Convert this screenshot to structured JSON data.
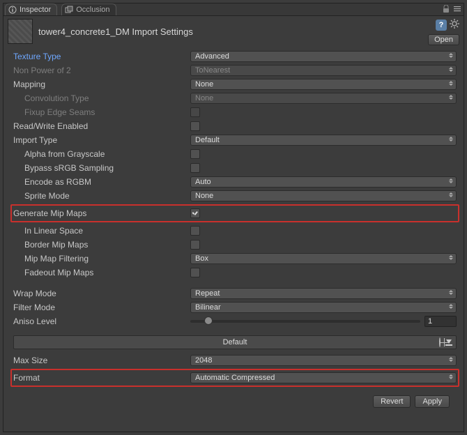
{
  "tabs": {
    "inspector": "Inspector",
    "occlusion": "Occlusion"
  },
  "header": {
    "title": "tower4_concrete1_DM Import Settings",
    "open": "Open"
  },
  "fields": {
    "texture_type": {
      "label": "Texture Type",
      "value": "Advanced"
    },
    "non_power_of_2": {
      "label": "Non Power of 2",
      "value": "ToNearest"
    },
    "mapping": {
      "label": "Mapping",
      "value": "None"
    },
    "convolution_type": {
      "label": "Convolution Type",
      "value": "None"
    },
    "fixup_edge_seams": {
      "label": "Fixup Edge Seams",
      "checked": false
    },
    "read_write_enabled": {
      "label": "Read/Write Enabled",
      "checked": false
    },
    "import_type": {
      "label": "Import Type",
      "value": "Default"
    },
    "alpha_from_grayscale": {
      "label": "Alpha from Grayscale",
      "checked": false
    },
    "bypass_srgb": {
      "label": "Bypass sRGB Sampling",
      "checked": false
    },
    "encode_as_rgbm": {
      "label": "Encode as RGBM",
      "value": "Auto"
    },
    "sprite_mode": {
      "label": "Sprite Mode",
      "value": "None"
    },
    "generate_mip_maps": {
      "label": "Generate Mip Maps",
      "checked": true
    },
    "in_linear_space": {
      "label": "In Linear Space",
      "checked": false
    },
    "border_mip_maps": {
      "label": "Border Mip Maps",
      "checked": false
    },
    "mip_map_filtering": {
      "label": "Mip Map Filtering",
      "value": "Box"
    },
    "fadeout_mip_maps": {
      "label": "Fadeout Mip Maps",
      "checked": false
    },
    "wrap_mode": {
      "label": "Wrap Mode",
      "value": "Repeat"
    },
    "filter_mode": {
      "label": "Filter Mode",
      "value": "Bilinear"
    },
    "aniso_level": {
      "label": "Aniso Level",
      "value": "1"
    },
    "platform": {
      "label": "Default"
    },
    "max_size": {
      "label": "Max Size",
      "value": "2048"
    },
    "format": {
      "label": "Format",
      "value": "Automatic Compressed"
    }
  },
  "footer": {
    "revert": "Revert",
    "apply": "Apply"
  }
}
